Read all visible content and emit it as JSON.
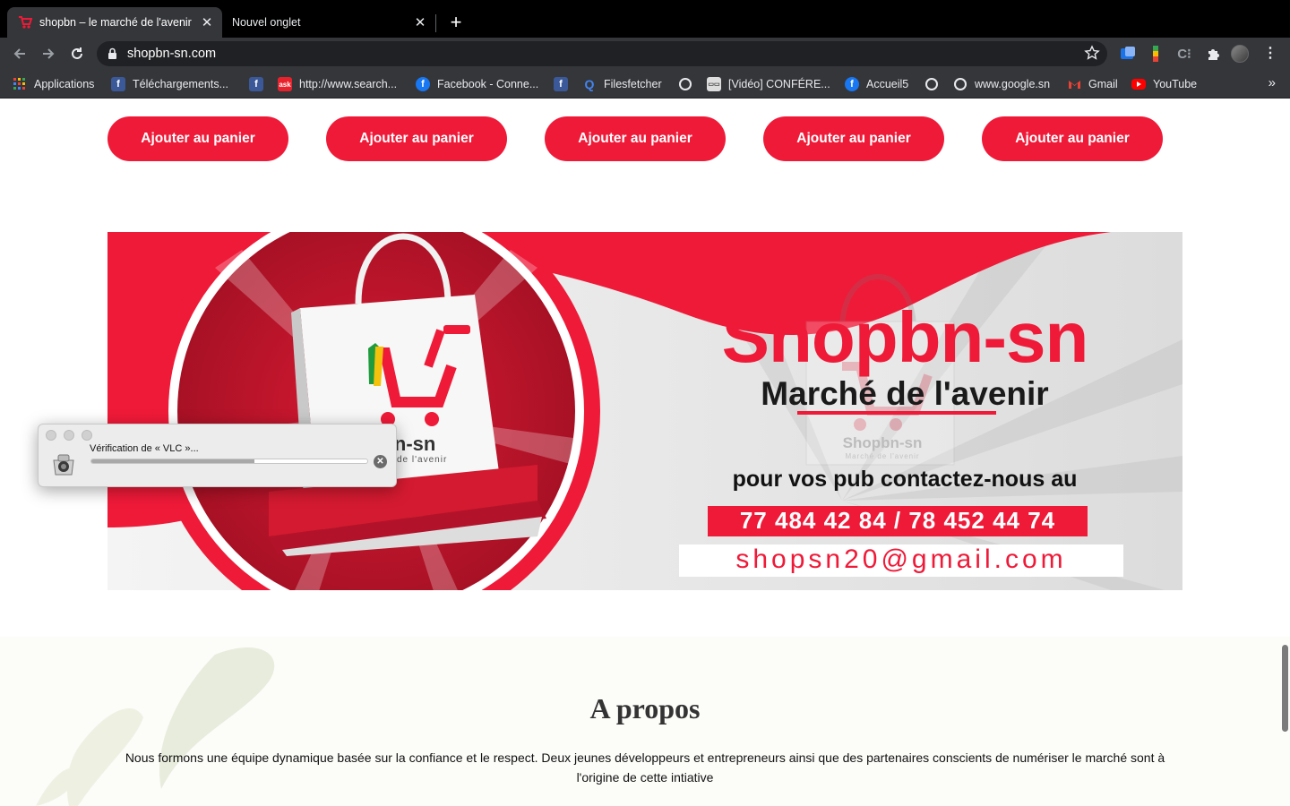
{
  "tabs": [
    {
      "title": "shopbn – le marché de l'avenir",
      "active": true
    },
    {
      "title": "Nouvel onglet",
      "active": false
    }
  ],
  "toolbar": {
    "url": "shopbn-sn.com",
    "back_icon": "arrow-left-icon",
    "forward_icon": "arrow-right-icon",
    "reload_icon": "reload-icon"
  },
  "bookmarks": [
    {
      "label": "Applications",
      "icon": "apps-grid-icon"
    },
    {
      "label": "Téléchargements...",
      "icon": "facebook-icon"
    },
    {
      "label": "",
      "icon": "facebook-icon"
    },
    {
      "label": "http://www.search...",
      "icon": "ask-icon"
    },
    {
      "label": "Facebook - Conne...",
      "icon": "facebook-icon"
    },
    {
      "label": "",
      "icon": "facebook-icon"
    },
    {
      "label": "Filesfetcher",
      "icon": "search-q-icon"
    },
    {
      "label": "",
      "icon": "globe-icon"
    },
    {
      "label": "[Vidéo] CONFÉRE...",
      "icon": "video-icon"
    },
    {
      "label": "Accueil5",
      "icon": "facebook-icon"
    },
    {
      "label": "",
      "icon": "globe-icon"
    },
    {
      "label": "www.google.sn",
      "icon": "globe-icon"
    },
    {
      "label": "Gmail",
      "icon": "gmail-icon"
    },
    {
      "label": "YouTube",
      "icon": "youtube-icon"
    }
  ],
  "products": {
    "add_to_cart_labels": [
      "Ajouter au panier",
      "Ajouter au panier",
      "Ajouter au panier",
      "Ajouter au panier",
      "Ajouter au panier"
    ]
  },
  "banner": {
    "brand": "Shopbn-sn",
    "tagline": "Marché de l'avenir",
    "logo_brand": "Shopbn-sn",
    "logo_tagline": "Marché de l'avenir",
    "bag_logo_text": "pbn-sn",
    "bag_logo_tagline": "de l'avenir",
    "cta": "pour vos pub contactez-nous au",
    "phones": "77 484 42 84 / 78 452 44 74",
    "email": "shopsn20@gmail.com",
    "colors": {
      "red": "#ef1a38",
      "dark_red": "#c4122c"
    }
  },
  "about": {
    "title": "A propos",
    "text": "Nous formons une équipe dynamique basée sur la confiance et le respect. Deux jeunes développeurs et entrepreneurs ainsi que des partenaires conscients de numériser le marché sont à l'origine de cette intiative"
  },
  "dialog": {
    "label": "Vérification de « VLC »...",
    "progress": 0.59,
    "icon": "vlc-installer-icon"
  },
  "colors": {
    "accent": "#ef1a38",
    "chrome_dark": "#35363a",
    "tabbar": "#000000"
  }
}
